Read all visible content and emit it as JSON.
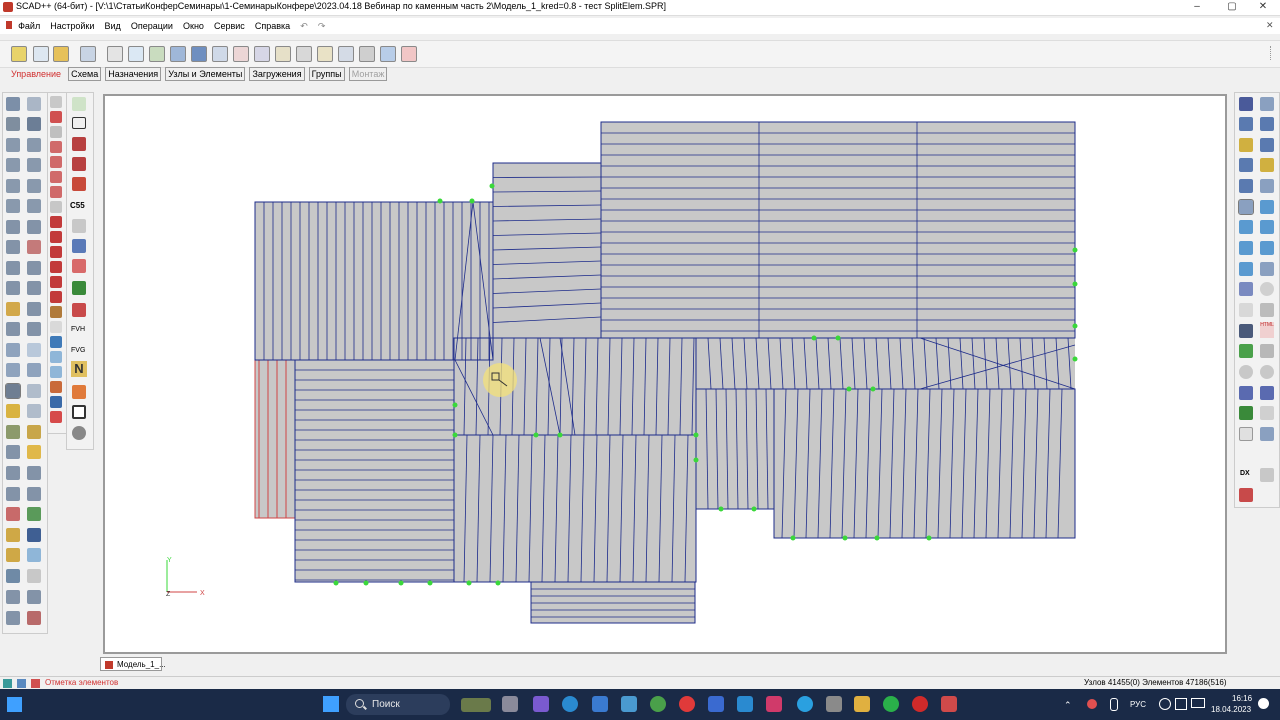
{
  "window": {
    "title": "SCAD++ (64-бит) - [V:\\1\\СтатьиКонферСеминары\\1-СеминарыКонфере\\2023.04.18 Вебинар по каменным часть 2\\Модель_1_kred=0.8 - тест SplitElem.SPR]",
    "controls": {
      "minimize": "–",
      "maximize": "▢",
      "close": "✕"
    }
  },
  "menu": {
    "items": [
      "Файл",
      "Настройки",
      "Вид",
      "Операции",
      "Окно",
      "Сервис",
      "Справка"
    ],
    "undo_icon": "undo-icon",
    "redo_icon": "redo-icon"
  },
  "tabs": [
    {
      "label": "Управление",
      "state": "active"
    },
    {
      "label": "Схема",
      "state": "normal"
    },
    {
      "label": "Назначения",
      "state": "normal"
    },
    {
      "label": "Узлы и Элементы",
      "state": "normal"
    },
    {
      "label": "Загружения",
      "state": "normal"
    },
    {
      "label": "Группы",
      "state": "normal"
    },
    {
      "label": "Монтаж",
      "state": "disabled"
    }
  ],
  "left_panel_labels": {
    "css": "C55",
    "fvh": "FVH",
    "fvg": "FVG",
    "n": "N"
  },
  "right_panel_labels": {
    "dx": "DX",
    "html": "HTML"
  },
  "axes": {
    "y": "Y",
    "z": "Z",
    "x": "X"
  },
  "document_tab": {
    "label": "Модель_1_..."
  },
  "status": {
    "left": "Отметка элементов",
    "right": "Узлов 41455(0) Элементов 47186(516)"
  },
  "taskbar": {
    "search_placeholder": "Поиск",
    "language": "РУС",
    "time": "16:16",
    "date": "18.04.2023"
  },
  "colors": {
    "mesh_fill": "#c8c8c8",
    "mesh_line": "#1d2b8a",
    "node_marker": "#3ad83a",
    "selected_fragment": "#d04545",
    "cursor_highlight": "#f4e27a"
  }
}
